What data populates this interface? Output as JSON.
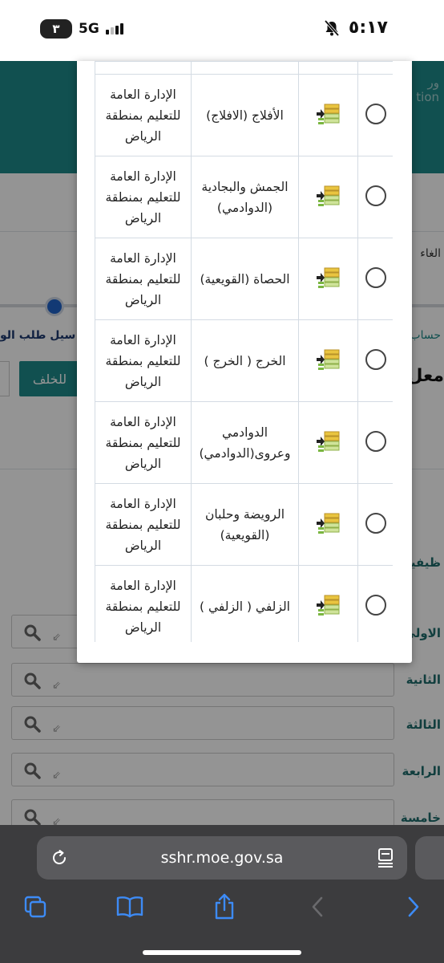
{
  "status_bar": {
    "notification_count": "٣",
    "network": "5G",
    "time": "٥:١٧",
    "mute_icon": "bell-slash-icon"
  },
  "background": {
    "header_edge_text": "ﻭﺭ\ntion",
    "cancel_text": "الغاء",
    "step_text": "سيل طلب الو",
    "account_text": "حساب",
    "teacher_text": "معل",
    "back_button": "للخلف",
    "job_text": "ظيفية",
    "fields": [
      {
        "label": "الاولى"
      },
      {
        "label": "الثانية"
      },
      {
        "label": "الثالثة"
      },
      {
        "label": "الرابعة"
      },
      {
        "label": "خامسة"
      }
    ]
  },
  "modal": {
    "rows": [
      {
        "name": "الأفلاج (الافلاج)",
        "department": "الإدارة العامة للتعليم بمنطقة الرياض"
      },
      {
        "name": "الجمش والبجادية (الدوادمي)",
        "department": "الإدارة العامة للتعليم بمنطقة الرياض"
      },
      {
        "name": "الحصاة (القويعية)",
        "department": "الإدارة العامة للتعليم بمنطقة الرياض"
      },
      {
        "name": "الخرج ( الخرج )",
        "department": "الإدارة العامة للتعليم بمنطقة الرياض"
      },
      {
        "name": "الدوادمي وعروى(الدوادمي)",
        "department": "الإدارة العامة للتعليم بمنطقة الرياض"
      },
      {
        "name": "الرويضة وحلبان (القويعية)",
        "department": "الإدارة العامة للتعليم بمنطقة الرياض"
      },
      {
        "name": "الزلفي ( الزلفي )",
        "department": "الإدارة العامة للتعليم بمنطقة الرياض"
      }
    ]
  },
  "browser": {
    "url": "sshr.moe.gov.sa"
  }
}
